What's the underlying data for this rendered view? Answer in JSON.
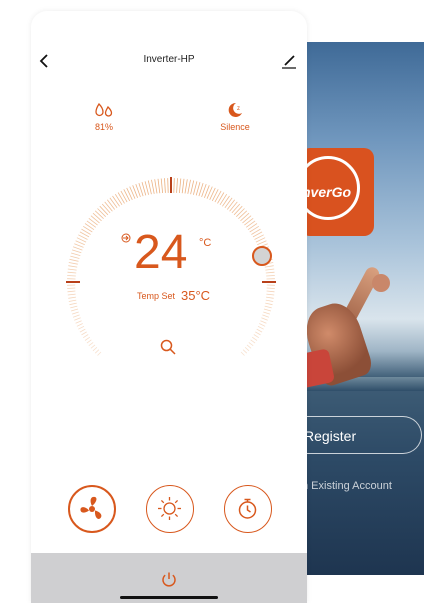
{
  "device": {
    "title": "Inverter-HP"
  },
  "stats": {
    "humidity": {
      "value": "81%",
      "icon": "humidity-icon"
    },
    "mode": {
      "value": "Silence",
      "icon": "moon-icon"
    }
  },
  "temperature": {
    "current": "24",
    "unit": "°C",
    "set_label": "Temp Set",
    "set_value": "35°C"
  },
  "controls": {
    "fan": {
      "icon": "fan-icon"
    },
    "sun": {
      "icon": "sun-icon"
    },
    "timer": {
      "icon": "timer-icon"
    }
  },
  "background_app": {
    "logo_text": "nverGo",
    "register_label": "Register",
    "existing_label": "n Existing Account"
  },
  "colors": {
    "accent": "#d8581d",
    "bottom_bar": "#cfcfd1"
  }
}
